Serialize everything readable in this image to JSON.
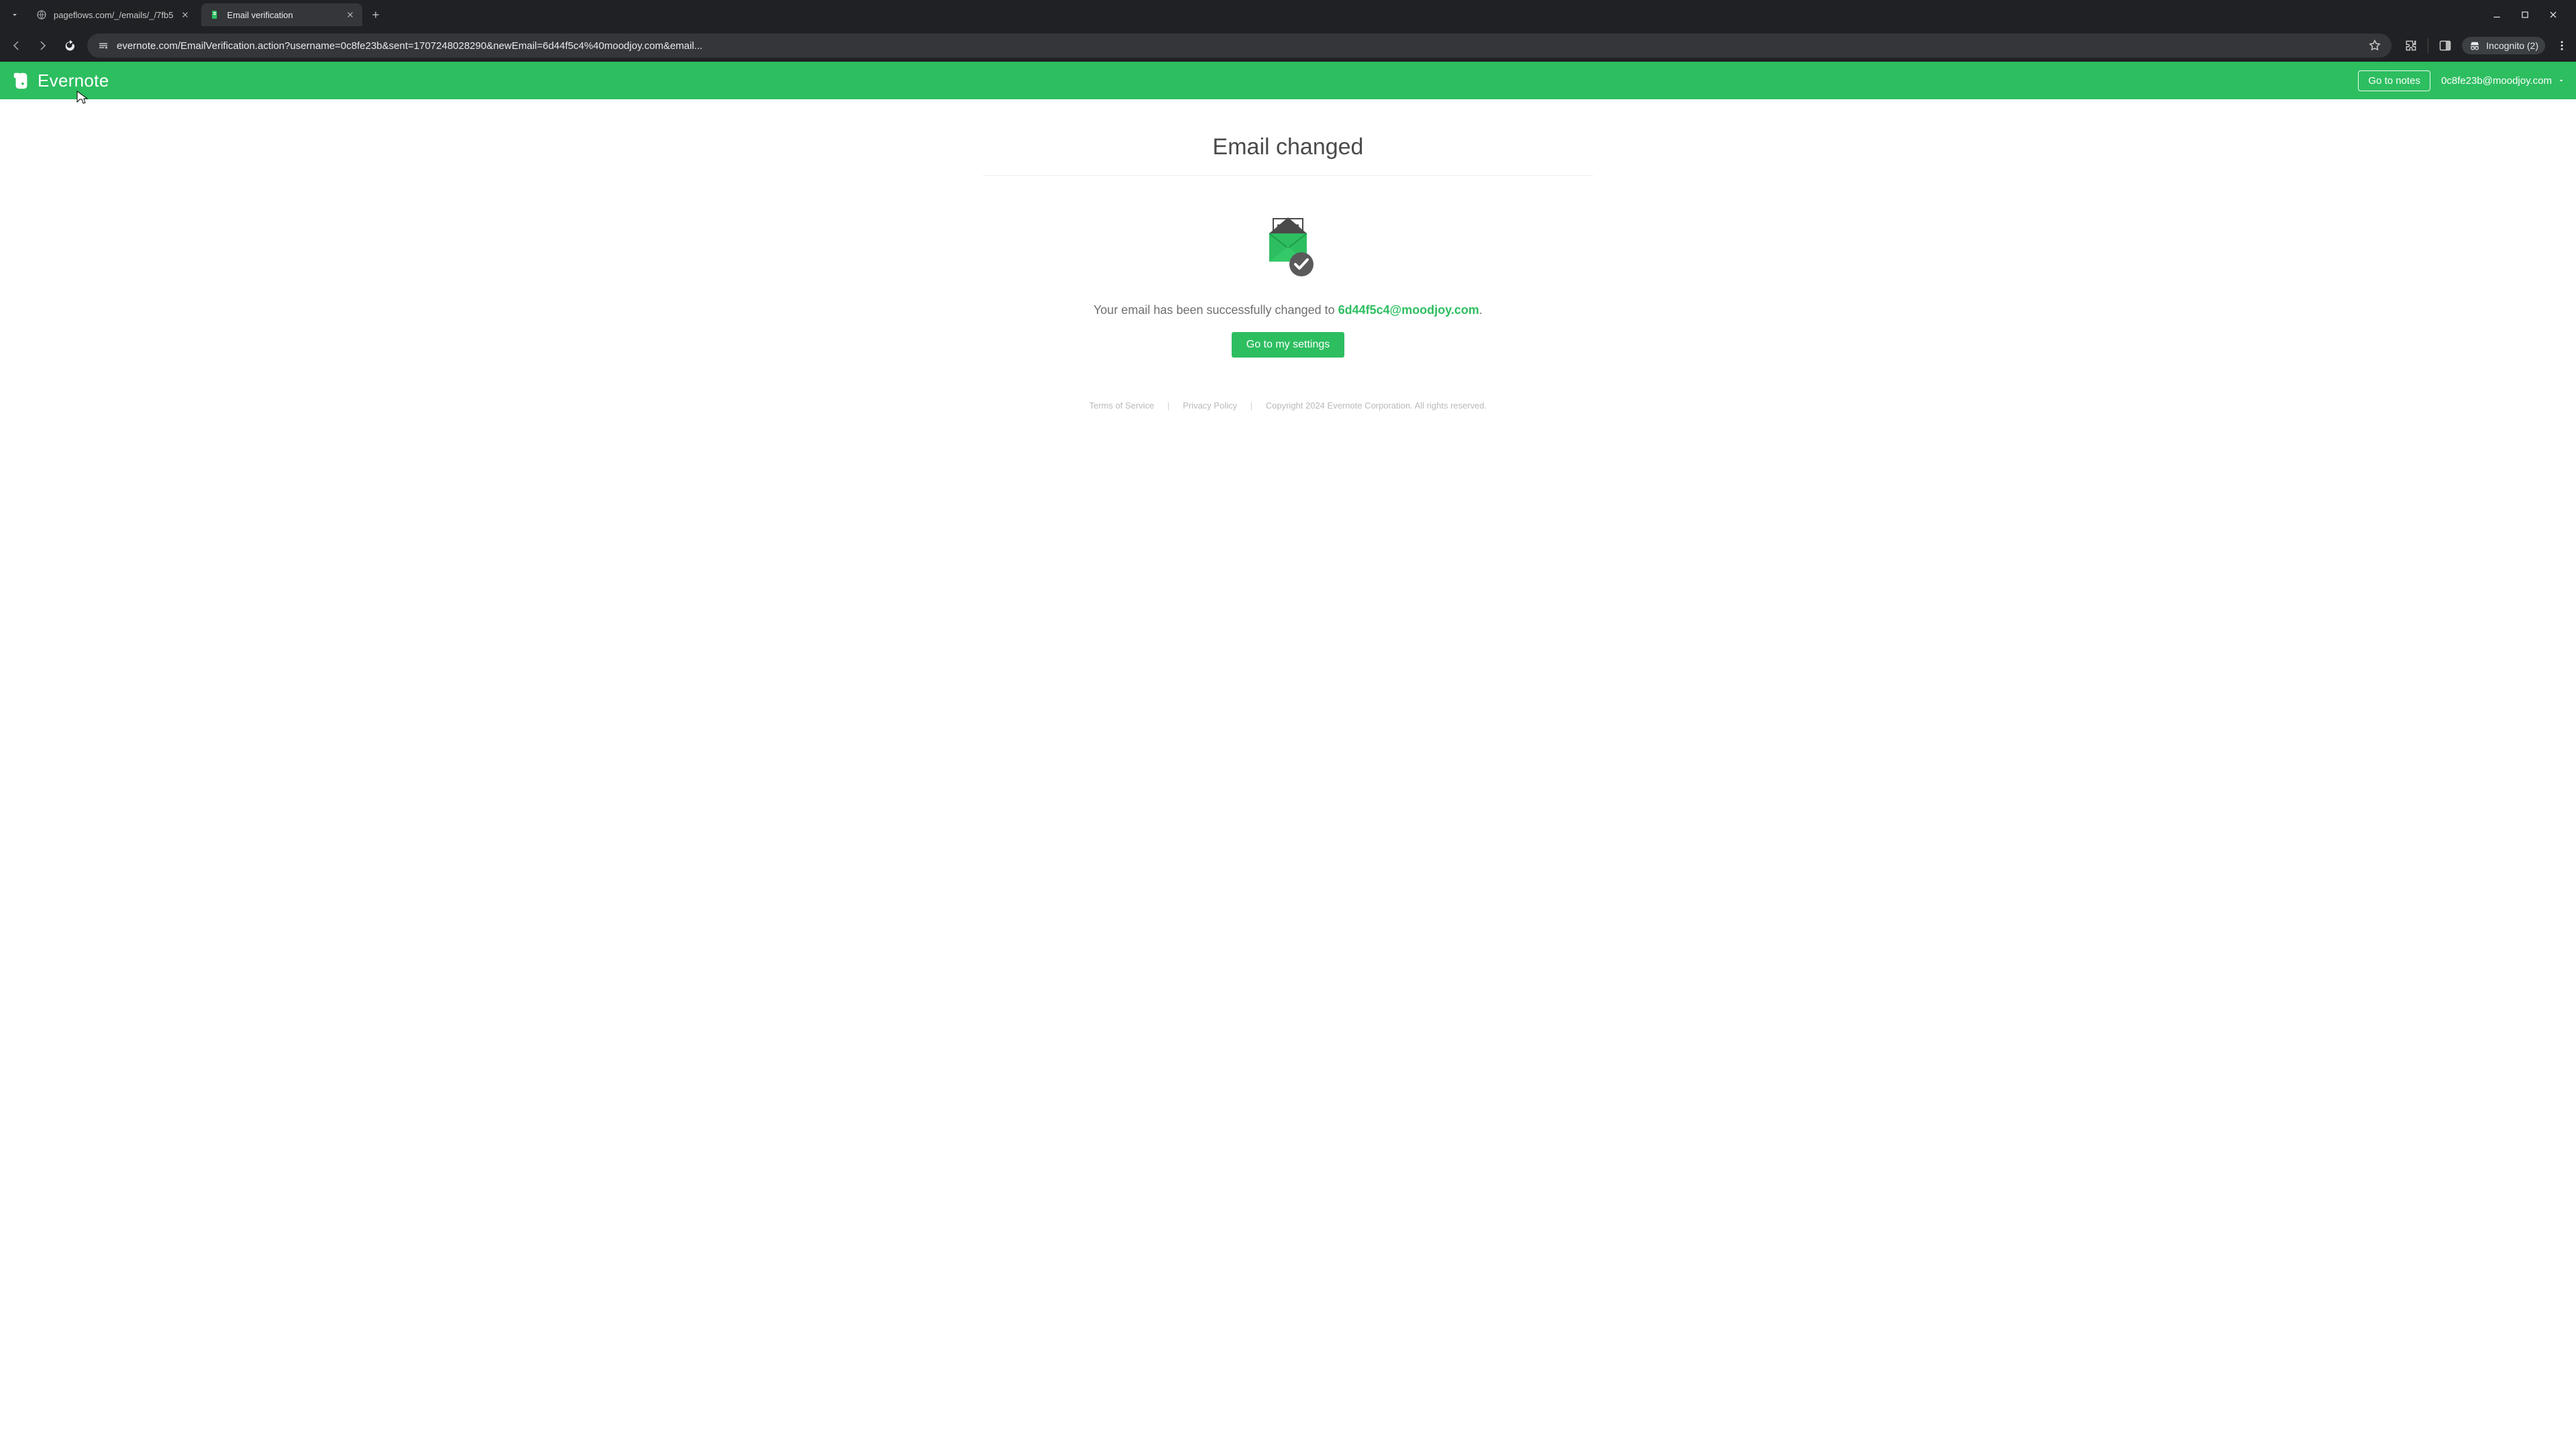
{
  "browser": {
    "tabs": [
      {
        "title": "pageflows.com/_/emails/_/7fb5",
        "active": false
      },
      {
        "title": "Email verification",
        "active": true
      }
    ],
    "url": "evernote.com/EmailVerification.action?username=0c8fe23b&sent=1707248028290&newEmail=6d44f5c4%40moodjoy.com&email...",
    "incognito_label": "Incognito (2)"
  },
  "header": {
    "brand": "Evernote",
    "go_to_notes_label": "Go to notes",
    "account_email": "0c8fe23b@moodjoy.com"
  },
  "content": {
    "title": "Email changed",
    "message_prefix": "Your email has been successfully changed to ",
    "new_email": "6d44f5c4@moodjoy.com",
    "message_suffix": ".",
    "cta_label": "Go to my settings"
  },
  "footer": {
    "terms_label": "Terms of Service",
    "privacy_label": "Privacy Policy",
    "copyright": "Copyright 2024 Evernote Corporation. All rights reserved."
  }
}
